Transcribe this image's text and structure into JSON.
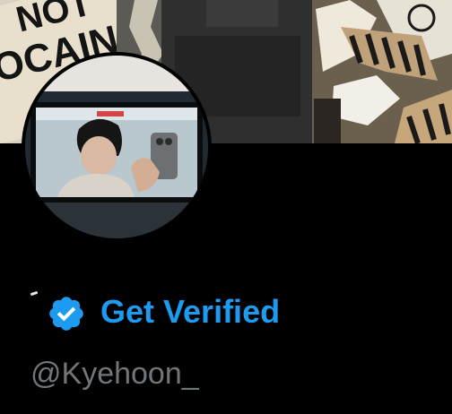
{
  "banner": {
    "sign_line_1": "NOT",
    "sign_line_2": "OCAINE"
  },
  "profile": {
    "avatar_icon": "profile-photo",
    "verified_icon": "verified-badge-icon",
    "get_verified_label": "Get Verified",
    "handle": "@Kyehoon_"
  },
  "colors": {
    "background": "#000000",
    "accent": "#1d9bf0",
    "handle_text": "#71767b"
  }
}
